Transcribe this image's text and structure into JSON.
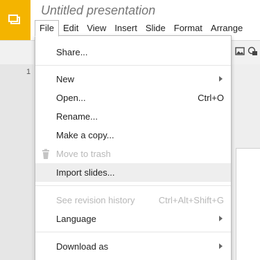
{
  "app": {
    "title": "Untitled presentation",
    "icon": "slides-logo-icon",
    "brand_color": "#f4b400"
  },
  "menubar": {
    "items": [
      "File",
      "Edit",
      "View",
      "Insert",
      "Slide",
      "Format",
      "Arrange"
    ],
    "active": "File"
  },
  "filmstrip": {
    "slide_number": "1"
  },
  "file_menu": {
    "share": "Share...",
    "new": "New",
    "open": "Open...",
    "open_shortcut": "Ctrl+O",
    "rename": "Rename...",
    "make_copy": "Make a copy...",
    "move_to_trash": "Move to trash",
    "import_slides": "Import slides...",
    "revision_history": "See revision history",
    "revision_shortcut": "Ctrl+Alt+Shift+G",
    "language": "Language",
    "download_as": "Download as"
  },
  "colors": {
    "hover_bg": "#eeeeee",
    "disabled_text": "#b8b8b8"
  }
}
